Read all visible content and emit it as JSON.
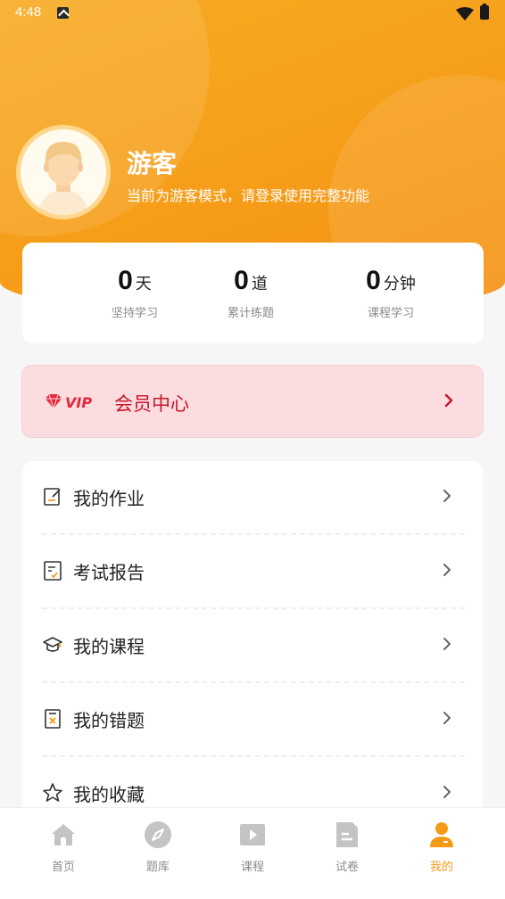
{
  "status_bar": {
    "time": "4:48"
  },
  "profile": {
    "name": "游客",
    "description": "当前为游客模式，请登录使用完整功能"
  },
  "stats": [
    {
      "value": "0",
      "unit": "天",
      "label": "坚持学习"
    },
    {
      "value": "0",
      "unit": "道",
      "label": "累计练题"
    },
    {
      "value": "0",
      "unit": "分钟",
      "label": "课程学习"
    }
  ],
  "vip": {
    "badge": "VIP",
    "label": "会员中心"
  },
  "menu": [
    {
      "label": "我的作业",
      "icon": "homework-icon"
    },
    {
      "label": "考试报告",
      "icon": "report-icon"
    },
    {
      "label": "我的课程",
      "icon": "graduation-cap-icon"
    },
    {
      "label": "我的错题",
      "icon": "wrong-question-icon"
    },
    {
      "label": "我的收藏",
      "icon": "star-icon"
    }
  ],
  "tabs": [
    {
      "label": "首页",
      "icon": "home-icon"
    },
    {
      "label": "题库",
      "icon": "compass-icon"
    },
    {
      "label": "课程",
      "icon": "play-icon"
    },
    {
      "label": "试卷",
      "icon": "paper-icon"
    },
    {
      "label": "我的",
      "icon": "user-icon",
      "active": true
    }
  ],
  "colors": {
    "accent": "#f49a17",
    "vip": "#c8152a",
    "vip_bg": "#fbdde0"
  }
}
